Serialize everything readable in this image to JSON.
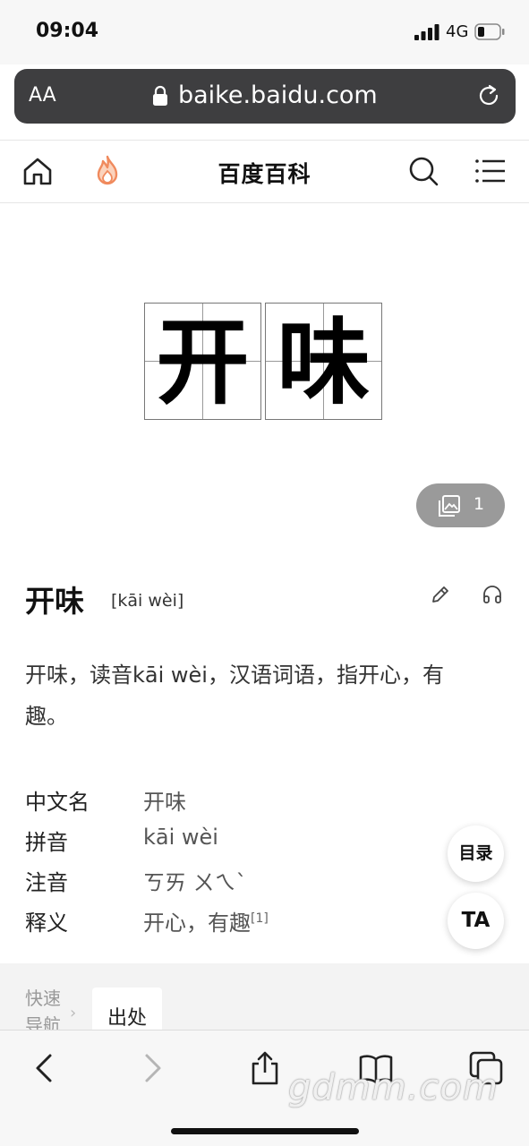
{
  "status": {
    "time": "09:04",
    "network": "4G"
  },
  "browser": {
    "text_size_label": "AA",
    "url": "baike.baidu.com"
  },
  "site": {
    "title": "百度百科"
  },
  "entry": {
    "characters": [
      "开",
      "味"
    ],
    "image_count": "1",
    "title": "开味",
    "pinyin": "[kāi wèi]",
    "summary": "开味，读音kāi wèi，汉语词语，指开心，有趣。",
    "info": [
      {
        "key": "中文名",
        "value": "开味",
        "ref": ""
      },
      {
        "key": "拼音",
        "value": "kāi wèi",
        "ref": ""
      },
      {
        "key": "注音",
        "value": "ㄎㄞ ㄨㄟˋ",
        "ref": ""
      },
      {
        "key": "释义",
        "value": "开心，有趣",
        "ref": "[1]"
      }
    ]
  },
  "floating": {
    "toc": "目录",
    "ta": "TA"
  },
  "quick_nav": {
    "label": "快速导航",
    "items": [
      "出处"
    ]
  },
  "watermark": "gdmm.com",
  "colors": {
    "url_bar": "#3e3e40",
    "album_button": "#9a9a9a",
    "fire_icon": "#f08a5d"
  }
}
